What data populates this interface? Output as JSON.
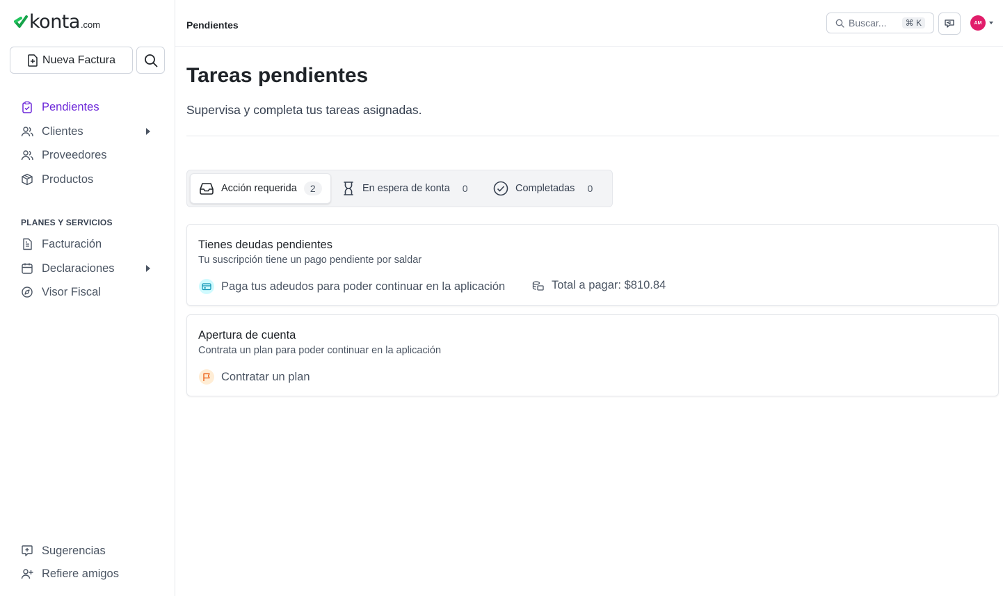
{
  "brand": {
    "name": "konta",
    "suffix": ".com",
    "color": "#16a34a"
  },
  "sidebar": {
    "new_invoice_label": "Nueva Factura",
    "items": [
      {
        "label": "Pendientes",
        "icon": "clipboard-check-icon",
        "active": true
      },
      {
        "label": "Clientes",
        "icon": "users-icon",
        "expandable": true
      },
      {
        "label": "Proveedores",
        "icon": "users-icon"
      },
      {
        "label": "Productos",
        "icon": "box-icon"
      }
    ],
    "section_title": "PLANES Y SERVICIOS",
    "services": [
      {
        "label": "Facturación",
        "icon": "document-icon"
      },
      {
        "label": "Declaraciones",
        "icon": "calendar-icon",
        "expandable": true
      },
      {
        "label": "Visor Fiscal",
        "icon": "compass-icon"
      }
    ],
    "footer": [
      {
        "label": "Sugerencias",
        "icon": "feedback-icon"
      },
      {
        "label": "Refiere amigos",
        "icon": "user-plus-icon"
      }
    ]
  },
  "header": {
    "breadcrumb": "Pendientes",
    "search_placeholder": "Buscar...",
    "search_shortcut": "⌘ K",
    "avatar_initials": "AM",
    "avatar_color": "#e11d6a"
  },
  "main": {
    "title": "Tareas pendientes",
    "subtitle": "Supervisa y completa tus tareas asignadas.",
    "tabs": [
      {
        "label": "Acción requerida",
        "count": "2",
        "icon": "inbox-icon",
        "active": true
      },
      {
        "label": "En espera de konta",
        "count": "0",
        "icon": "hourglass-icon"
      },
      {
        "label": "Completadas",
        "count": "0",
        "icon": "check-circle-icon"
      }
    ],
    "cards": [
      {
        "title": "Tienes deudas pendientes",
        "description": "Tu suscripción tiene un pago pendiente por saldar",
        "action_label": "Paga tus adeudos para poder continuar en la aplicación",
        "action_icon": "credit-card-icon",
        "total_label": "Total a pagar: $810.84",
        "total_icon": "coins-icon"
      },
      {
        "title": "Apertura de cuenta",
        "description": "Contrata un plan para poder continuar en la aplicación",
        "action_label": "Contratar un plan",
        "action_icon": "flag-icon"
      }
    ]
  },
  "colors": {
    "accent": "#6d28d9",
    "card_icon_blue": "#cffafe",
    "card_icon_orange": "#ffedd5"
  }
}
